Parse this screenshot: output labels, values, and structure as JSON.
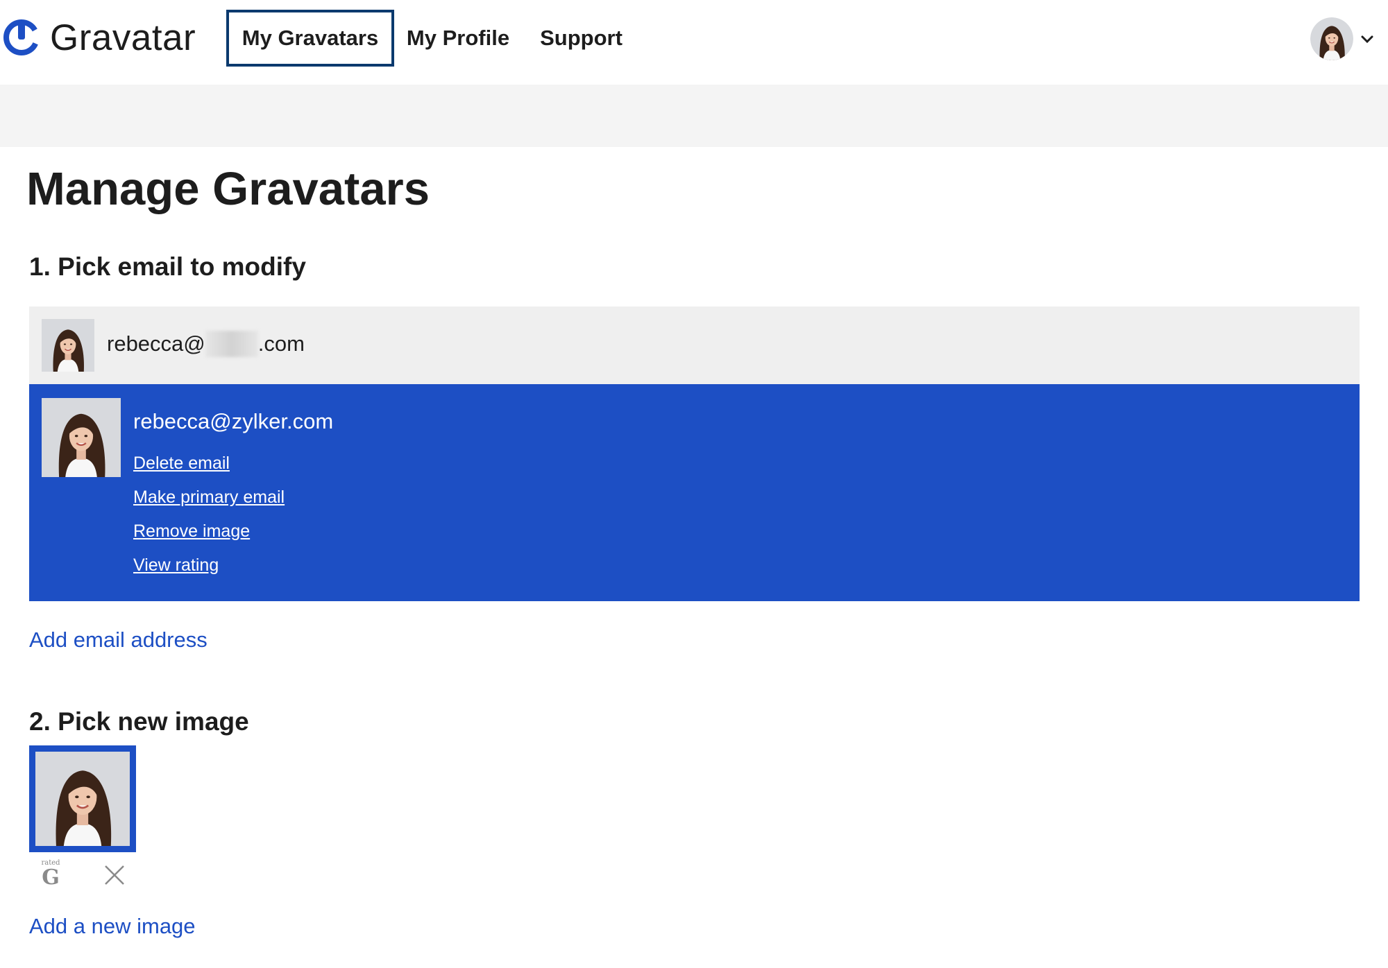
{
  "app": {
    "name": "Gravatar"
  },
  "nav": {
    "items": [
      {
        "label": "My Gravatars",
        "active": true
      },
      {
        "label": "My Profile",
        "active": false
      },
      {
        "label": "Support",
        "active": false
      }
    ],
    "user_menu_icon": "chevron-down-icon"
  },
  "page": {
    "title": "Manage Gravatars"
  },
  "section1": {
    "title": "1. Pick email to modify",
    "emails": [
      {
        "prefix": "rebecca@",
        "suffix": ".com",
        "obscured": true,
        "selected": false
      },
      {
        "address": "rebecca@zylker.com",
        "selected": true
      }
    ],
    "actions": [
      "Delete email",
      "Make primary email",
      "Remove image",
      "View rating"
    ],
    "add_email": "Add email address"
  },
  "section2": {
    "title": "2. Pick new image",
    "rating": {
      "small": "rated",
      "big": "G"
    },
    "remove_icon": "close-icon",
    "add_image": "Add a new image"
  },
  "colors": {
    "brand_blue": "#1d4fc4",
    "nav_active_border": "#0b3a6e",
    "row_inactive": "#efefef",
    "band_gray": "#f4f4f4"
  }
}
